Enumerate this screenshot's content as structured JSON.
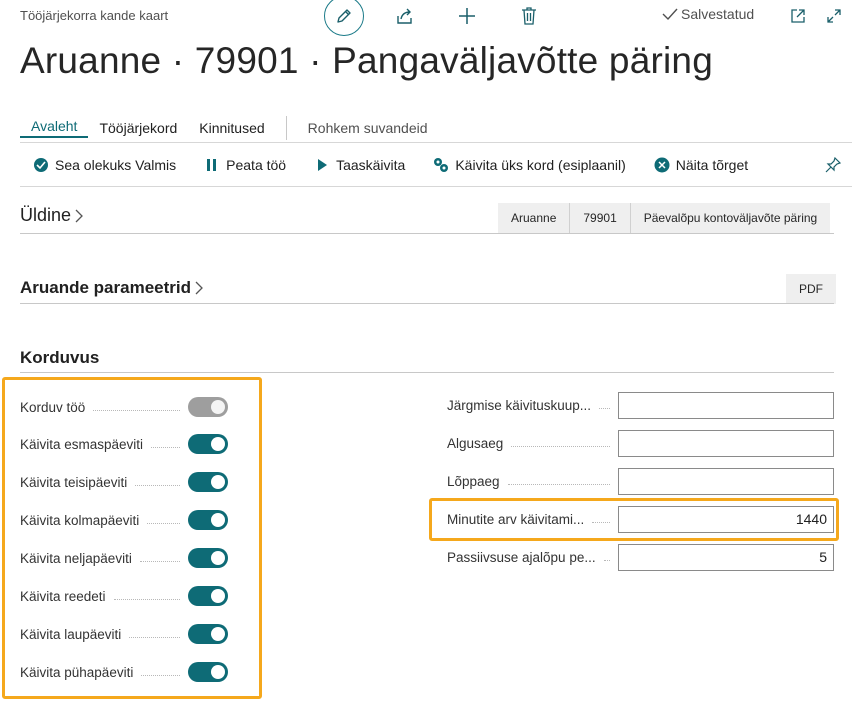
{
  "header": {
    "breadcrumb": "Tööjärjekorra kande kaart",
    "saved_status": "Salvestatud",
    "title": "Aruanne · 79901 · Pangaväljavõtte päring"
  },
  "tabs": [
    {
      "label": "Avaleht",
      "active": true
    },
    {
      "label": "Tööjärjekord"
    },
    {
      "label": "Kinnitused"
    },
    {
      "label": "Rohkem suvandeid"
    }
  ],
  "actions": [
    {
      "label": "Sea olekuks Valmis",
      "icon": "set-ready-icon"
    },
    {
      "label": "Peata töö",
      "icon": "pause-icon"
    },
    {
      "label": "Taaskäivita",
      "icon": "play-icon"
    },
    {
      "label": "Käivita üks kord (esiplaanil)",
      "icon": "run-once-icon"
    },
    {
      "label": "Näita tõrget",
      "icon": "error-icon"
    }
  ],
  "general": {
    "heading": "Üldine",
    "pills": [
      "Aruanne",
      "79901",
      "Päevalõpu kontoväljavõte päring"
    ]
  },
  "report_params": {
    "heading": "Aruande parameetrid",
    "pill": "PDF"
  },
  "recurrence": {
    "heading": "Korduvus",
    "toggles": [
      {
        "label": "Korduv töö",
        "on": true,
        "disabled": true
      },
      {
        "label": "Käivita esmaspäeviti",
        "on": true
      },
      {
        "label": "Käivita teisipäeviti",
        "on": true
      },
      {
        "label": "Käivita kolmapäeviti",
        "on": true
      },
      {
        "label": "Käivita neljapäeviti",
        "on": true
      },
      {
        "label": "Käivita reedeti",
        "on": true
      },
      {
        "label": "Käivita laupäeviti",
        "on": true
      },
      {
        "label": "Käivita pühapäeviti",
        "on": true
      }
    ],
    "fields": [
      {
        "label": "Järgmise käivituskuup...",
        "value": ""
      },
      {
        "label": "Algusaeg",
        "value": ""
      },
      {
        "label": "Lõppaeg",
        "value": ""
      },
      {
        "label": "Minutite arv käivitami...",
        "value": "1440"
      },
      {
        "label": "Passiivsuse ajalõpu pe...",
        "value": "5"
      }
    ]
  },
  "colors": {
    "accent": "#0e6b76",
    "highlight": "#f5a81c"
  }
}
